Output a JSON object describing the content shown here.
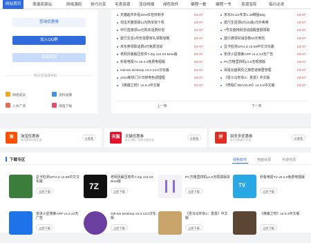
{
  "nav": [
    "网站首页",
    "靠谱资源站",
    "网络源码",
    "技巧分享",
    "毛表资源",
    "活动线报",
    "绿色软件",
    "编程一看",
    "编程一书",
    "资源宝库",
    "每日必发"
  ],
  "left": {
    "btn1": "查询优惠券",
    "btn2": "加入QQ群",
    "btn3": "投稿须知",
    "divider": "购分区快捷导航",
    "quick": [
      "网络成员",
      "资料投稿",
      "入会广场",
      "增值下载"
    ]
  },
  "news_left": [
    {
      "t": "天猫超市补贴25%红包快到手",
      "d": "04-07"
    },
    {
      "t": "淘宝天猫重磅11元购买双十机",
      "d": "04-07"
    },
    {
      "t": "中行直接领10元购买话费红包",
      "d": "04-07"
    },
    {
      "t": "建行生活4月份需要有礼领取攻略",
      "d": "04-07"
    },
    {
      "t": "京东券领取话费0元免费活动",
      "d": "04-07"
    },
    {
      "t": "老网页版解压软件7-Zip v24.04 Beta版",
      "d": "04-07"
    },
    {
      "t": "秒看电视TV v9.2.0免费电视版",
      "d": "04-07"
    },
    {
      "t": "GitHub Desktop v3.3.13.0汉化版",
      "d": "04-07"
    },
    {
      "t": "2023新热门计日常电色调理理",
      "d": "04-07"
    },
    {
      "t": "《英雄之时》v2.6.3中文版",
      "d": "04-07"
    }
  ],
  "news_right": [
    {
      "t": "京东PLUS专享1.48精猛50g",
      "d": "04-07"
    },
    {
      "t": "建行生活领5元10减2元外卖券",
      "d": "04-07"
    },
    {
      "t": "7号充值特别活动提醒金额领取",
      "d": "04-07"
    },
    {
      "t": "建行通领好消息卷50元电信",
      "d": "04-07"
    },
    {
      "t": "显卡检测GPU-Z v2.58中文汉化版",
      "d": "04-07"
    },
    {
      "t": "安卓火星搜索APP v1.2.24无广告",
      "d": "04-07"
    },
    {
      "t": "PC方格里拼机v1.5无规放版",
      "d": "04-07"
    },
    {
      "t": "百度云盘网页之旅密道家居管理",
      "d": "04-07"
    },
    {
      "t": "《冒斗马你杂2：重发》中文版",
      "d": "04-07"
    },
    {
      "t": "《奇幅亡DEVOUR》v4.3.6中文版",
      "d": "04-07"
    }
  ],
  "pager": {
    "prev": "上一条",
    "next": "下一条"
  },
  "promos": [
    {
      "logo": "淘",
      "name": "淘宝优惠券",
      "sub": "每天都有新券优惠",
      "go": "去看看",
      "color": "#ff5000"
    },
    {
      "logo": "天猫",
      "name": "天猫优惠券",
      "sub": "每天领取一张券大额优惠",
      "go": "去看看",
      "color": "#e3122b"
    },
    {
      "logo": "拼",
      "name": "拼多多优惠券",
      "sub": "每天领取最大优惠",
      "go": "去看看",
      "color": "#e02e24"
    }
  ],
  "downloads": {
    "title": "下载专区",
    "tabs": [
      "绿色软件",
      "电脑资源",
      "手游资源"
    ],
    "items": [
      {
        "t": "显卡检测GPU-Z v2.58中文汉化版",
        "btn": "立即下载",
        "color": "#3b7d3b"
      },
      {
        "t": "老网页解压软件7-Zip v24.04 Beta版",
        "btn": "立即下载",
        "color": "#111111"
      },
      {
        "t": "PC方格里拼机v1.5无限屏版本",
        "btn": "立即下载",
        "color": "#f4f2f9"
      },
      {
        "t": "秒看电视TV v9.2.0免费电视版",
        "btn": "立即下载",
        "color": "#2aa8e6"
      },
      {
        "t": "安卓火星搜索APP v1.2.24无广告",
        "btn": "立即下载",
        "color": "#1e73e8"
      },
      {
        "t": "GitHub Desktop v3.3.13.0汉化版",
        "btn": "立即下载",
        "color": "#6b3fa0"
      },
      {
        "t": "《冒马马你杂2：重发》中文版",
        "btn": "立即下载",
        "color": "#c9a46a"
      },
      {
        "t": "《英雄之时》v2.6.3中文版",
        "btn": "立即下载",
        "color": "#5a4633"
      }
    ]
  }
}
